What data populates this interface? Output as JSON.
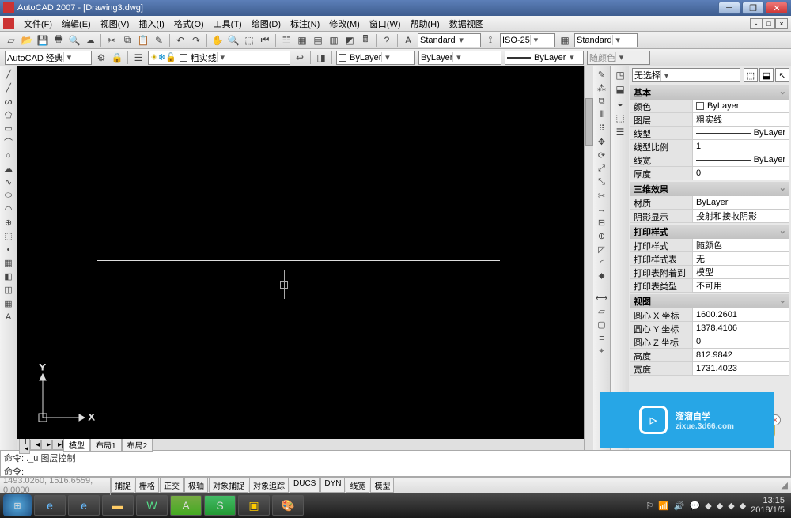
{
  "title": "AutoCAD 2007 - [Drawing3.dwg]",
  "menus": [
    "文件(F)",
    "编辑(E)",
    "视图(V)",
    "插入(I)",
    "格式(O)",
    "工具(T)",
    "绘图(D)",
    "标注(N)",
    "修改(M)",
    "窗口(W)",
    "帮助(H)",
    "数据视图"
  ],
  "toolbar1": {
    "textStyle": "Standard",
    "dimStyle": "ISO-25",
    "tableStyle": "Standard"
  },
  "toolbar2": {
    "workspace": "AutoCAD 经典",
    "layer": "粗实线",
    "colorCombo": "ByLayer",
    "linetypeCombo": "ByLayer",
    "lineweightCombo": "ByLayer",
    "plotCombo": "随颜色"
  },
  "propsPanel": {
    "selector": "无选择",
    "groups": {
      "basic": {
        "title": "基本",
        "rows": {
          "color": {
            "label": "颜色",
            "value": "ByLayer"
          },
          "layer": {
            "label": "图层",
            "value": "粗实线"
          },
          "linetype": {
            "label": "线型",
            "value": "ByLayer"
          },
          "ltscale": {
            "label": "线型比例",
            "value": "1"
          },
          "lineweight": {
            "label": "线宽",
            "value": "ByLayer"
          },
          "thickness": {
            "label": "厚度",
            "value": "0"
          }
        }
      },
      "three_d": {
        "title": "三维效果",
        "rows": {
          "material": {
            "label": "材质",
            "value": "ByLayer"
          },
          "shadow": {
            "label": "阴影显示",
            "value": "投射和接收阴影"
          }
        }
      },
      "plot": {
        "title": "打印样式",
        "rows": {
          "pstyle": {
            "label": "打印样式",
            "value": "随颜色"
          },
          "ptable": {
            "label": "打印样式表",
            "value": "无"
          },
          "pattach": {
            "label": "打印表附着到",
            "value": "模型"
          },
          "ptype": {
            "label": "打印表类型",
            "value": "不可用"
          }
        }
      },
      "view": {
        "title": "视图",
        "rows": {
          "cx": {
            "label": "圆心 X 坐标",
            "value": "1600.2601"
          },
          "cy": {
            "label": "圆心 Y 坐标",
            "value": "1378.4106"
          },
          "cz": {
            "label": "圆心 Z 坐标",
            "value": "0"
          },
          "h": {
            "label": "高度",
            "value": "812.9842"
          },
          "w": {
            "label": "宽度",
            "value": "1731.4023"
          }
        }
      }
    }
  },
  "tabs": {
    "model": "模型",
    "layout1": "布局1",
    "layout2": "布局2"
  },
  "command": {
    "line1": "命令: ._u 图层控制",
    "line2prefix": "命令:",
    "line2value": ""
  },
  "status": {
    "coords": "1493.0260, 1516.6559, 0.0000",
    "modes": [
      "捕捉",
      "栅格",
      "正交",
      "极轴",
      "对象捕捉",
      "对象追踪",
      "DUCS",
      "DYN",
      "线宽",
      "模型"
    ]
  },
  "taskbar": {
    "time": "13:15",
    "date": "2018/1/5"
  },
  "watermark": {
    "brand": "溜溜自学",
    "url": "zixue.3d66.com"
  }
}
